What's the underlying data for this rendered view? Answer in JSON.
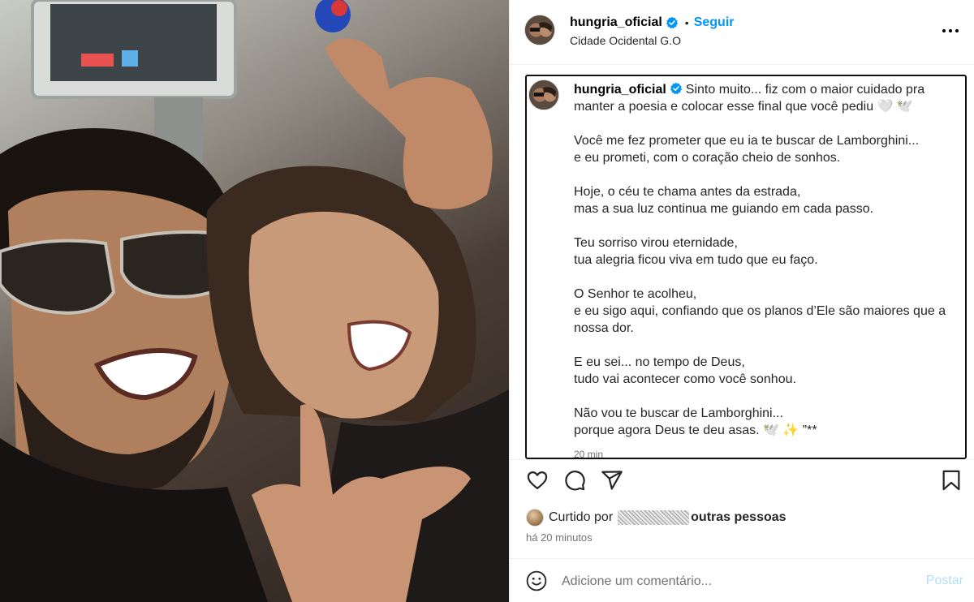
{
  "post": {
    "username": "hungria_oficial",
    "follow_label": "Seguir",
    "separator": "•",
    "location": "Cidade Ocidental G.O"
  },
  "caption": {
    "username": "hungria_oficial",
    "paragraphs": [
      "Sinto muito... fiz com o maior cuidado pra manter a poesia e colocar esse final que você pediu 🤍 🕊️",
      "Você me fez prometer que eu ia te buscar de Lamborghini...\ne eu prometi, com o coração cheio de sonhos.",
      "Hoje, o céu te chama antes da estrada,\nmas a sua luz continua me guiando em cada passo.",
      "Teu sorriso virou eternidade,\ntua alegria ficou viva em tudo que eu faço.",
      "O Senhor te acolheu,\ne eu sigo aqui, confiando que os planos d’Ele são maiores que a nossa dor.",
      "E eu sei... no tempo de Deus,\ntudo vai acontecer como você sonhou.",
      "Não vou te buscar de Lamborghini...\nporque agora Deus te deu asas. 🕊️ ✨ ”**"
    ],
    "time": "20 min"
  },
  "likes": {
    "prefix": "Curtido por",
    "others": "outras pessoas"
  },
  "posted_time": "há 20 minutos",
  "comment": {
    "placeholder": "Adicione um comentário...",
    "post_label": "Postar"
  },
  "colors": {
    "accent": "#0095f6",
    "post_disabled": "#b2dffc",
    "secondary_text": "#737373"
  },
  "icons": [
    "verified-badge-icon",
    "more-options-icon",
    "heart-icon",
    "comment-icon",
    "share-icon",
    "bookmark-icon",
    "emoji-icon"
  ]
}
